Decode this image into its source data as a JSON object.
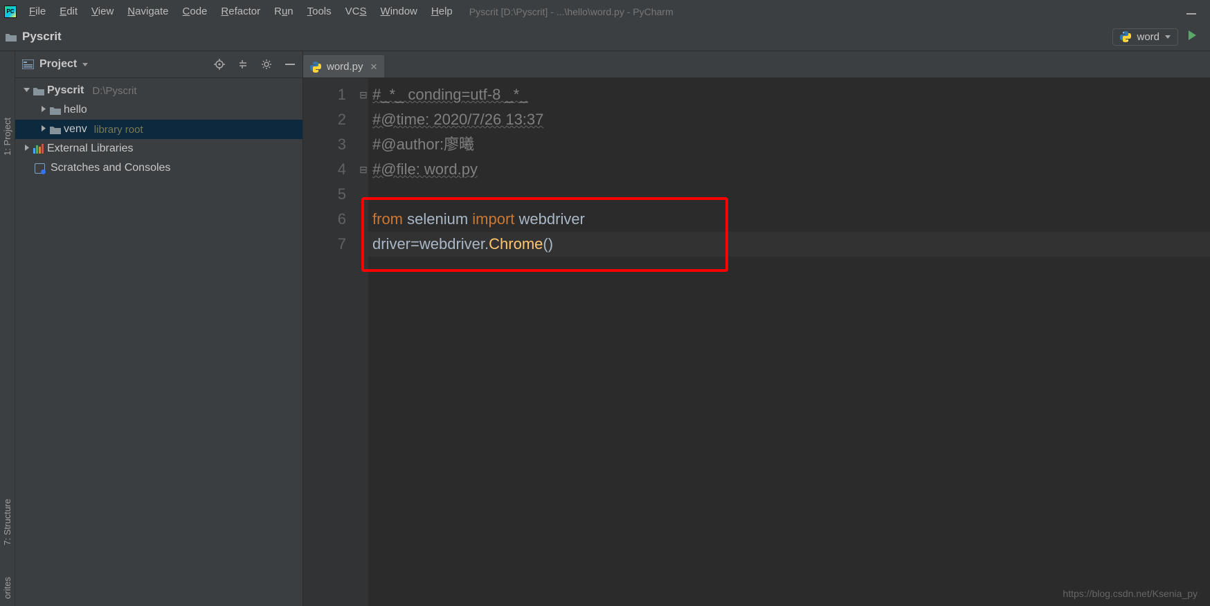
{
  "app_icon_text": "PC",
  "menu": {
    "file": "File",
    "edit": "Edit",
    "view": "View",
    "navigate": "Navigate",
    "code": "Code",
    "refactor": "Refactor",
    "run": "Run",
    "tools": "Tools",
    "vcs": "VCS",
    "window": "Window",
    "help": "Help"
  },
  "title": "Pyscrit [D:\\Pyscrit] - ...\\hello\\word.py - PyCharm",
  "breadcrumb": {
    "root": "Pyscrit"
  },
  "run_config": {
    "label": "word"
  },
  "left_tabs": {
    "project": "1: Project",
    "structure": "7: Structure",
    "favorites": "orites"
  },
  "project_panel": {
    "title": "Project",
    "tree": {
      "root": {
        "name": "Pyscrit",
        "path": "D:\\Pyscrit"
      },
      "hello": "hello",
      "venv": {
        "name": "venv",
        "tag": "library root"
      },
      "ext": "External Libraries",
      "scratch": "Scratches and Consoles"
    }
  },
  "editor": {
    "tab_name": "word.py",
    "lines": {
      "1": "#_*_ conding=utf-8 _*_",
      "2": "#@time: 2020/7/26 13:37",
      "3": "#@author:廖曦",
      "4": "#@file: word.py",
      "5": "",
      "6a": "from",
      "6b": " selenium ",
      "6c": "import",
      "6d": " webdriver",
      "7a": "driver",
      "7b": "=webdriver.",
      "7c": "Chrome",
      "7d": "()"
    },
    "gutter": [
      "1",
      "2",
      "3",
      "4",
      "5",
      "6",
      "7"
    ]
  },
  "watermark": "https://blog.csdn.net/Ksenia_py"
}
